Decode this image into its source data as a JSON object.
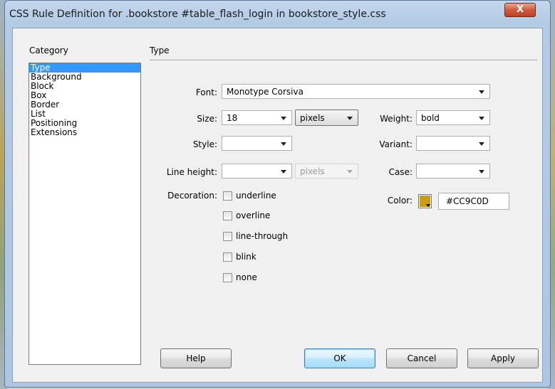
{
  "window": {
    "title": "CSS Rule Definition for .bookstore #table_flash_login in bookstore_style.css",
    "close_label": "X"
  },
  "category": {
    "header": "Category",
    "items": [
      "Type",
      "Background",
      "Block",
      "Box",
      "Border",
      "List",
      "Positioning",
      "Extensions"
    ],
    "selected": "Type"
  },
  "panel": {
    "title": "Type"
  },
  "fields": {
    "font": {
      "label": "Font:",
      "value": "Monotype Corsiva"
    },
    "size": {
      "label": "Size:",
      "value": "18",
      "unit": "pixels"
    },
    "weight": {
      "label": "Weight:",
      "value": "bold"
    },
    "style": {
      "label": "Style:",
      "value": ""
    },
    "variant": {
      "label": "Variant:",
      "value": ""
    },
    "line_height": {
      "label": "Line height:",
      "value": "",
      "unit": "pixels"
    },
    "case": {
      "label": "Case:",
      "value": ""
    },
    "color": {
      "label": "Color:",
      "value": "#CC9C0D",
      "swatch": "#cc9c0d"
    }
  },
  "decoration": {
    "label": "Decoration:",
    "options": [
      {
        "label": "underline",
        "checked": false
      },
      {
        "label": "overline",
        "checked": false
      },
      {
        "label": "line-through",
        "checked": false
      },
      {
        "label": "blink",
        "checked": false
      },
      {
        "label": "none",
        "checked": false
      }
    ]
  },
  "buttons": {
    "help": "Help",
    "ok": "OK",
    "cancel": "Cancel",
    "apply": "Apply"
  },
  "colors": {
    "selection": "#3399ff",
    "title_bar": "#b3cbe5",
    "close": "#c23f1f"
  }
}
